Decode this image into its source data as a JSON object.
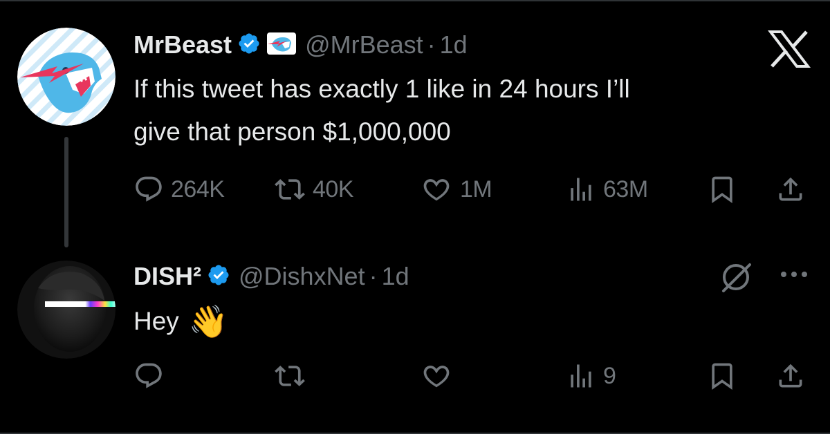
{
  "tweet": {
    "author_name": "MrBeast",
    "handle": "@MrBeast",
    "separator": "·",
    "time": "1d",
    "text_line1": "If this tweet has exactly 1 like in 24 hours I’ll",
    "text_line2": "give that person $1,000,000",
    "stats": {
      "replies": "264K",
      "reposts": "40K",
      "likes": "1M",
      "views": "63M"
    }
  },
  "reply": {
    "author_name": "DISH²",
    "handle": "@DishxNet",
    "separator": "·",
    "time": "1d",
    "text": "Hey",
    "emoji": "👋",
    "stats": {
      "views": "9"
    }
  },
  "icons": {
    "verified": "verified-badge-icon",
    "x_logo": "x-logo-icon",
    "reply": "reply-icon",
    "repost": "repost-icon",
    "like": "heart-icon",
    "views": "views-icon",
    "bookmark": "bookmark-icon",
    "share": "share-icon",
    "grok": "grok-icon",
    "more": "more-icon"
  },
  "colors": {
    "background": "#000000",
    "text": "#e7e9ea",
    "muted": "#71767b",
    "verified": "#1d9bf0"
  }
}
